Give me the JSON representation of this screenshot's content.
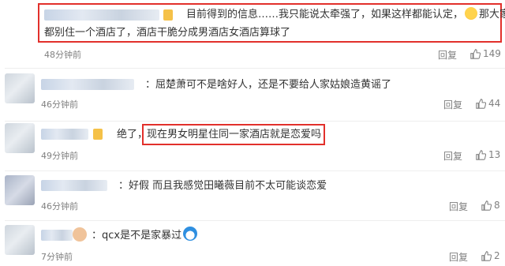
{
  "comments": [
    {
      "text_part1": "目前得到的信息……我只能说太牵强了，如果这样都能认定，",
      "text_part1_end": "那大家",
      "text_line2": "都别住一个酒店了，酒店干脆分成男酒店女酒店算球了",
      "time": "48分钟前",
      "reply": "回复",
      "likes": "149",
      "emoji": "sweat-face-icon"
    },
    {
      "text": "屈楚萧可不是啥好人，还是不要给人家姑娘造黄谣了",
      "time": "46分钟前",
      "reply": "回复",
      "likes": "44"
    },
    {
      "text_pre": "绝了，",
      "text_boxed": "现在男女明星住同一家酒店就是恋爱吗",
      "time": "49分钟前",
      "reply": "回复",
      "likes": "13"
    },
    {
      "text": "好假 而且我感觉田曦薇目前不太可能谈恋爱",
      "time": "46分钟前",
      "reply": "回复",
      "likes": "8"
    },
    {
      "text": "qcx是不是家暴过",
      "time": "7分钟前",
      "reply": "回复",
      "likes": "2",
      "emoji": "doraemon-icon"
    }
  ],
  "colors": {
    "highlight": "#e2302b",
    "meta": "#808080",
    "text": "#333333"
  }
}
